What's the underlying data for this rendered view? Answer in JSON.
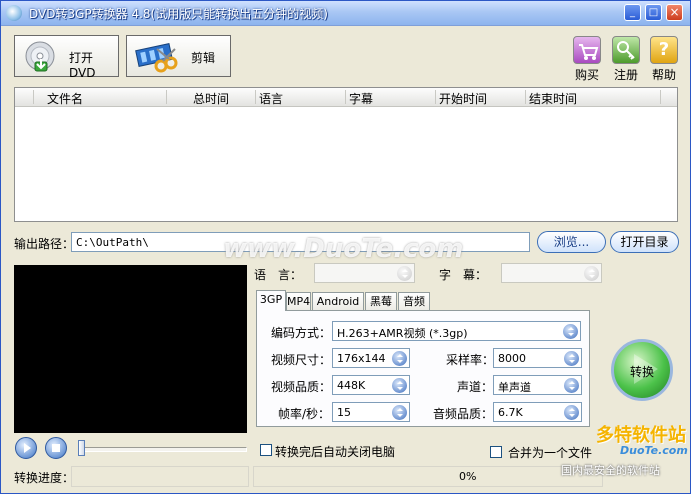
{
  "window": {
    "title": "DVD转3GP转换器 4.8(试用版只能转换出五分钟的视频)",
    "controls": {
      "minimize": "_",
      "maximize": "□",
      "close": "×"
    }
  },
  "toolbar": {
    "open_dvd_label": "打开DVD",
    "edit_label": "剪辑",
    "buy_label": "购买",
    "register_label": "注册",
    "help_label": "帮助",
    "help_glyph": "?"
  },
  "file_list": {
    "columns": [
      "文件名",
      "总时间",
      "语言",
      "字幕",
      "开始时间",
      "结束时间"
    ],
    "rows": []
  },
  "output": {
    "label": "输出路径：",
    "path": "C:\\OutPath\\",
    "browse_label": "浏览...",
    "open_dir_label": "打开目录"
  },
  "stream_select": {
    "language_label": "语　言：",
    "language_value": "",
    "subtitle_label": "字　幕：",
    "subtitle_value": ""
  },
  "format_tabs": {
    "items": [
      "3GP",
      "MP4",
      "Android",
      "黑莓",
      "音频"
    ],
    "active": "3GP"
  },
  "settings": {
    "codec_label": "编码方式：",
    "codec_value": "H.263+AMR视频 (*.3gp)",
    "size_label": "视频尺寸：",
    "size_value": "176x144",
    "quality_label": "视频品质：",
    "quality_value": "448K",
    "fps_label": "帧率/秒：",
    "fps_value": "15",
    "samplerate_label": "采样率：",
    "samplerate_value": "8000",
    "channel_label": "声道：",
    "channel_value": "单声道",
    "audio_quality_label": "音频品质：",
    "audio_quality_value": "6.7K"
  },
  "convert": {
    "label": "转换"
  },
  "options": {
    "shutdown_label": "转换完后自动关闭电脑",
    "shutdown_checked": false,
    "merge_label": "合并为一个文件",
    "merge_checked": false
  },
  "player": {
    "seek_fraction": 0
  },
  "progress": {
    "label": "转换进度：",
    "percent_text": "0%",
    "percent": 0
  },
  "watermarks": {
    "center": "www.DuoTe.com",
    "brand": "多特软件站",
    "brand_url": "DuoTe.com",
    "brand_slogan": "国内最安全的软件站"
  },
  "colors": {
    "titlebar": "#8db4ee",
    "window_bg": "#ece9d8",
    "accent_blue": "#2a5cd6",
    "convert_green": "#3cb043"
  }
}
